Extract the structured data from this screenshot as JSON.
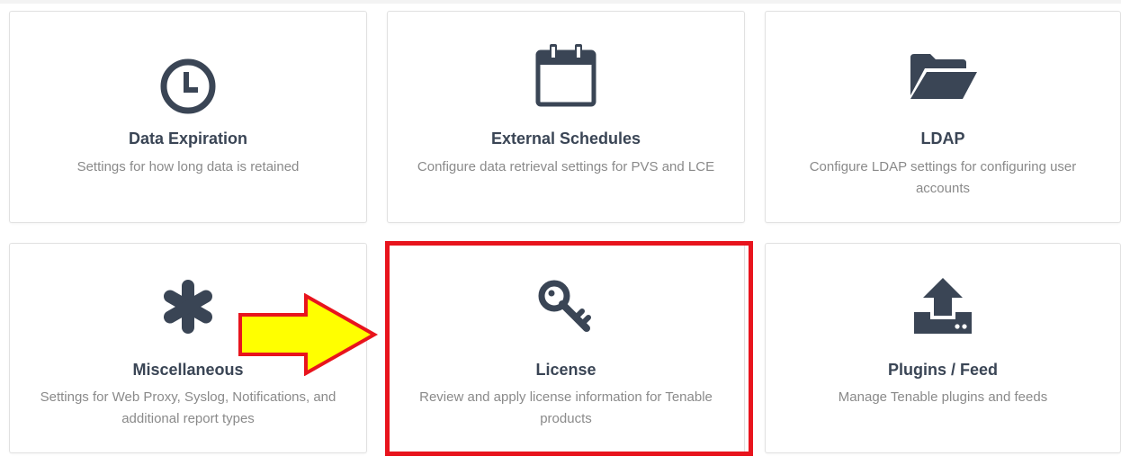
{
  "cards": [
    {
      "title": "Data Expiration",
      "description": "Settings for how long data is retained",
      "icon": "clock-icon"
    },
    {
      "title": "External Schedules",
      "description": "Configure data retrieval settings for PVS and LCE",
      "icon": "calendar-icon"
    },
    {
      "title": "LDAP",
      "description": "Configure LDAP settings for configuring user accounts",
      "icon": "folder-open-icon"
    },
    {
      "title": "Miscellaneous",
      "description": "Settings for Web Proxy, Syslog, Notifications, and additional report types",
      "icon": "asterisk-icon"
    },
    {
      "title": "License",
      "description": "Review and apply license information for Tenable products",
      "icon": "key-icon"
    },
    {
      "title": "Plugins / Feed",
      "description": "Manage Tenable plugins and feeds",
      "icon": "upload-icon"
    }
  ],
  "annotation": {
    "highlight_target": "License",
    "highlight_color": "#e8141d",
    "arrow_fill": "#ffff00",
    "arrow_stroke": "#e8141d"
  },
  "colors": {
    "icon": "#3a4555",
    "title": "#3a4555",
    "description": "#8a8a8a",
    "card_border": "#e1e1e1"
  }
}
